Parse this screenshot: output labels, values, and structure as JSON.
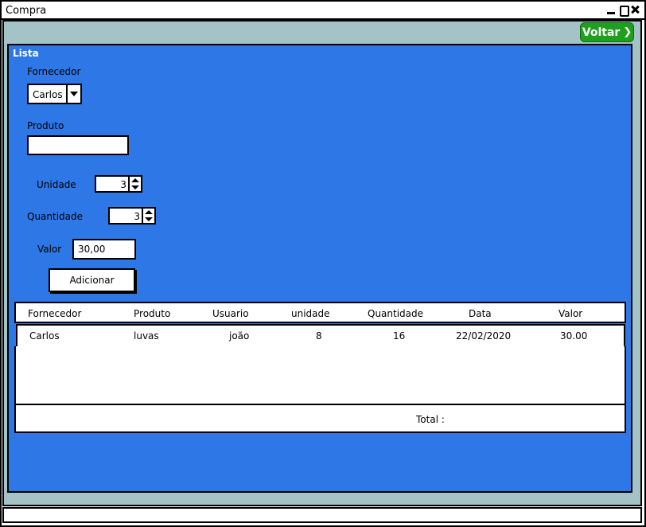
{
  "window": {
    "title": "Compra"
  },
  "toolbar": {
    "back_label": "Voltar"
  },
  "panel": {
    "title": "Lista"
  },
  "form": {
    "fornecedor_label": "Fornecedor",
    "fornecedor_value": "Carlos",
    "produto_label": "Produto",
    "produto_value": "",
    "unidade_label": "Unidade",
    "unidade_value": "3",
    "quantidade_label": "Quantidade",
    "quantidade_value": "3",
    "valor_label": "Valor",
    "valor_value": "30,00",
    "add_label": "Adicionar"
  },
  "table": {
    "headers": [
      "Fornecedor",
      "Produto",
      "Usuario",
      "unidade",
      "Quantidade",
      "Data",
      "Valor"
    ],
    "rows": [
      [
        "Carlos",
        "luvas",
        "joão",
        "8",
        "16",
        "22/02/2020",
        "30.00"
      ]
    ],
    "total_label": "Total :"
  },
  "colors": {
    "panel_bg": "#2d77e6",
    "frame_bg": "#a3c3c6",
    "back_button": "#1ea01e"
  },
  "icons": [
    "minimize-icon",
    "maximize-icon",
    "close-icon",
    "chevron-right-icon",
    "dropdown-arrow-icon",
    "stepper-arrows-icon"
  ]
}
